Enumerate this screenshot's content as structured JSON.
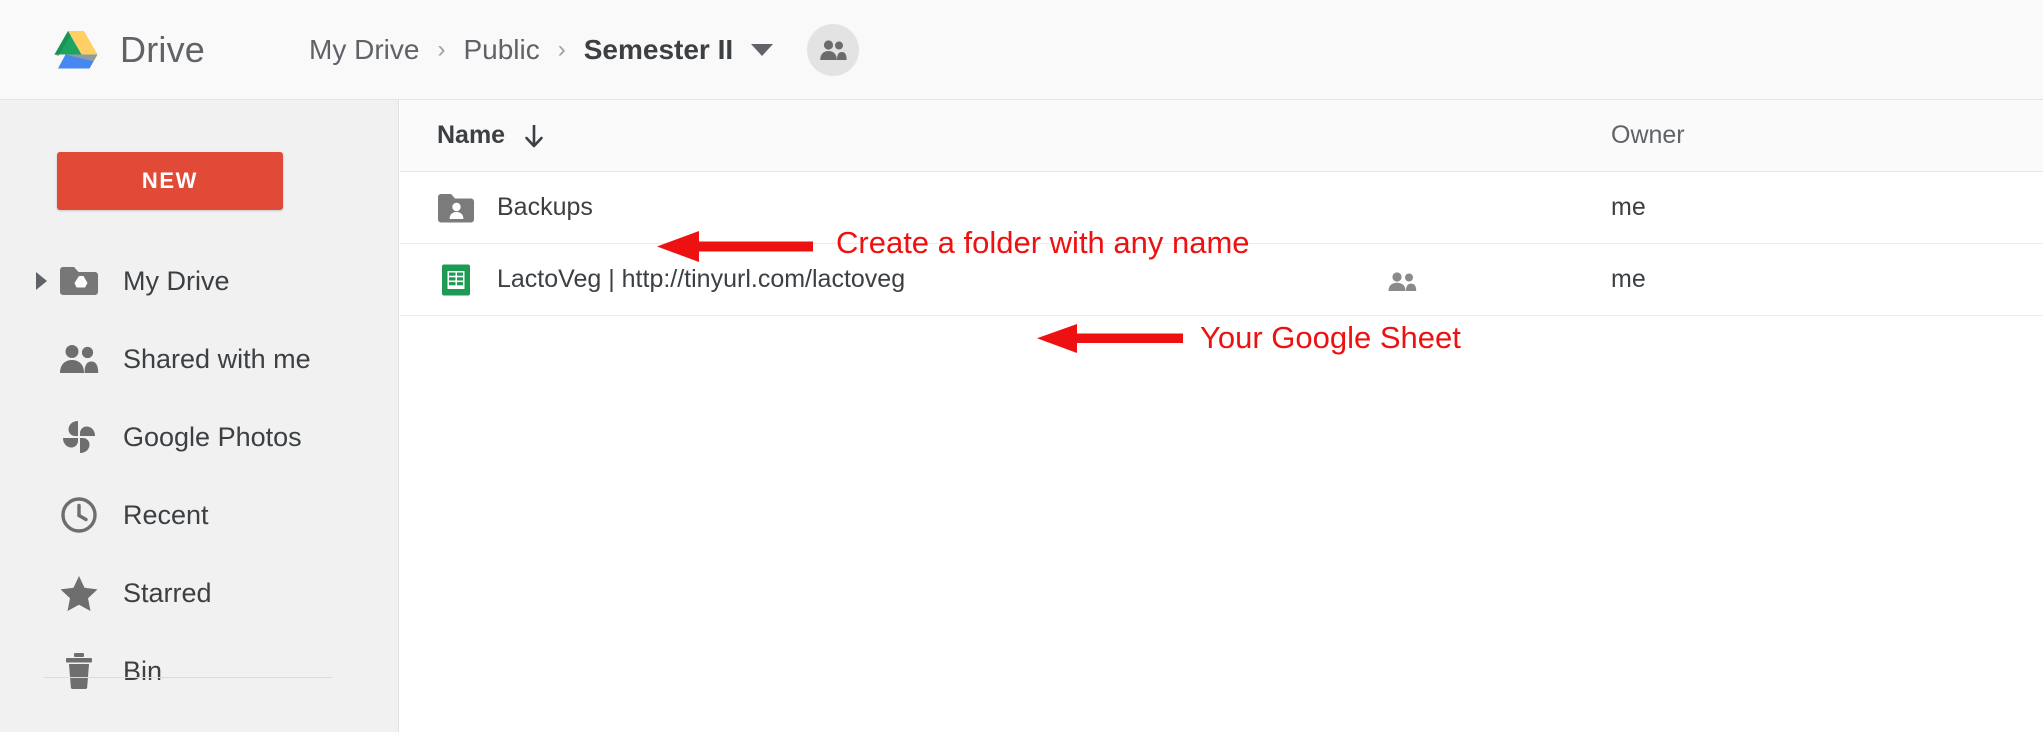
{
  "app": {
    "name": "Drive",
    "logo_icon": "google-drive-logo",
    "logo_colors": {
      "green": "#1DA462",
      "yellow": "#FFCF63",
      "blue": "#4688F1"
    }
  },
  "breadcrumb": {
    "items": [
      {
        "label": "My Drive",
        "current": false
      },
      {
        "label": "Public",
        "current": false
      },
      {
        "label": "Semester II",
        "current": true
      }
    ],
    "separator": "›",
    "dropdown_icon": "chevron-down-icon",
    "share_badge_icon": "people-icon"
  },
  "sidebar": {
    "new_button": {
      "label": "NEW",
      "color": "#E04A36"
    },
    "items": [
      {
        "label": "My Drive",
        "icon": "drive-folder-icon",
        "expandable": true
      },
      {
        "label": "Shared with me",
        "icon": "people-icon",
        "expandable": false
      },
      {
        "label": "Google Photos",
        "icon": "google-photos-pinwheel-icon",
        "expandable": false
      },
      {
        "label": "Recent",
        "icon": "clock-icon",
        "expandable": false
      },
      {
        "label": "Starred",
        "icon": "star-icon",
        "expandable": false
      },
      {
        "label": "Bin",
        "icon": "trash-icon",
        "expandable": false
      }
    ]
  },
  "file_list": {
    "columns": [
      {
        "label": "Name",
        "sort_icon": "arrow-down-icon",
        "sorted": true
      },
      {
        "label": "Owner",
        "sort_icon": null,
        "sorted": false
      }
    ],
    "rows": [
      {
        "name": "Backups",
        "icon": "shared-folder-icon",
        "owner": "me",
        "shared_icon": null
      },
      {
        "name": "LactoVeg | http://tinyurl.com/lactoveg",
        "icon": "google-sheets-icon",
        "owner": "me",
        "shared_icon": "people-icon"
      }
    ]
  },
  "annotations": {
    "color": "#EE1111",
    "items": [
      {
        "text": "Create a folder with any name",
        "arrow": "left-arrow",
        "target": "Backups"
      },
      {
        "text": "Your Google Sheet",
        "arrow": "left-arrow",
        "target": "LactoVeg | http://tinyurl.com/lactoveg"
      }
    ]
  }
}
